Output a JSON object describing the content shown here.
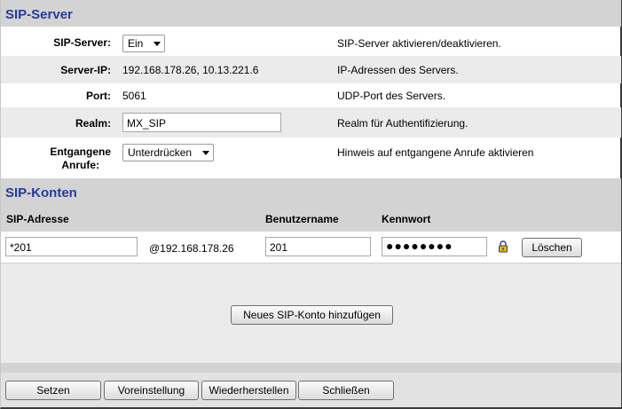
{
  "sip_server": {
    "title": "SIP-Server",
    "enable_label": "SIP-Server:",
    "enable_value": "Ein",
    "enable_desc": "SIP-Server aktivieren/deaktivieren.",
    "ip_label": "Server-IP:",
    "ip_value": "192.168.178.26, 10.13.221.6",
    "ip_desc": "IP-Adressen des Servers.",
    "port_label": "Port:",
    "port_value": "5061",
    "port_desc": "UDP-Port des Servers.",
    "realm_label": "Realm:",
    "realm_value": "MX_SIP",
    "realm_desc": "Realm für Authentifizierung.",
    "missed_label_1": "Entgangene",
    "missed_label_2": "Anrufe:",
    "missed_value": "Unterdrücken",
    "missed_desc": "Hinweis auf entgangene Anrufe aktivieren"
  },
  "sip_accounts": {
    "title": "SIP-Konten",
    "col_address": "SIP-Adresse",
    "col_username": "Benutzername",
    "col_password": "Kennwort",
    "rows": [
      {
        "address": "*201",
        "domain": "@192.168.178.26",
        "username": "201",
        "password_mask": "●●●●●●●●",
        "delete_label": "Löschen"
      }
    ],
    "add_label": "Neues SIP-Konto hinzufügen"
  },
  "footer": {
    "set_label": "Setzen",
    "default_label": "Voreinstellung",
    "restore_label": "Wiederherstellen",
    "close_label": "Schließen"
  },
  "colors": {
    "title": "#2a3a9a",
    "section_bg": "#d3d3d3",
    "row_alt_bg": "#ebebeb",
    "lock_icon": "#2a3a9a"
  },
  "icons": {
    "lock": "lock-icon",
    "dropdown": "chevron-down-icon"
  }
}
